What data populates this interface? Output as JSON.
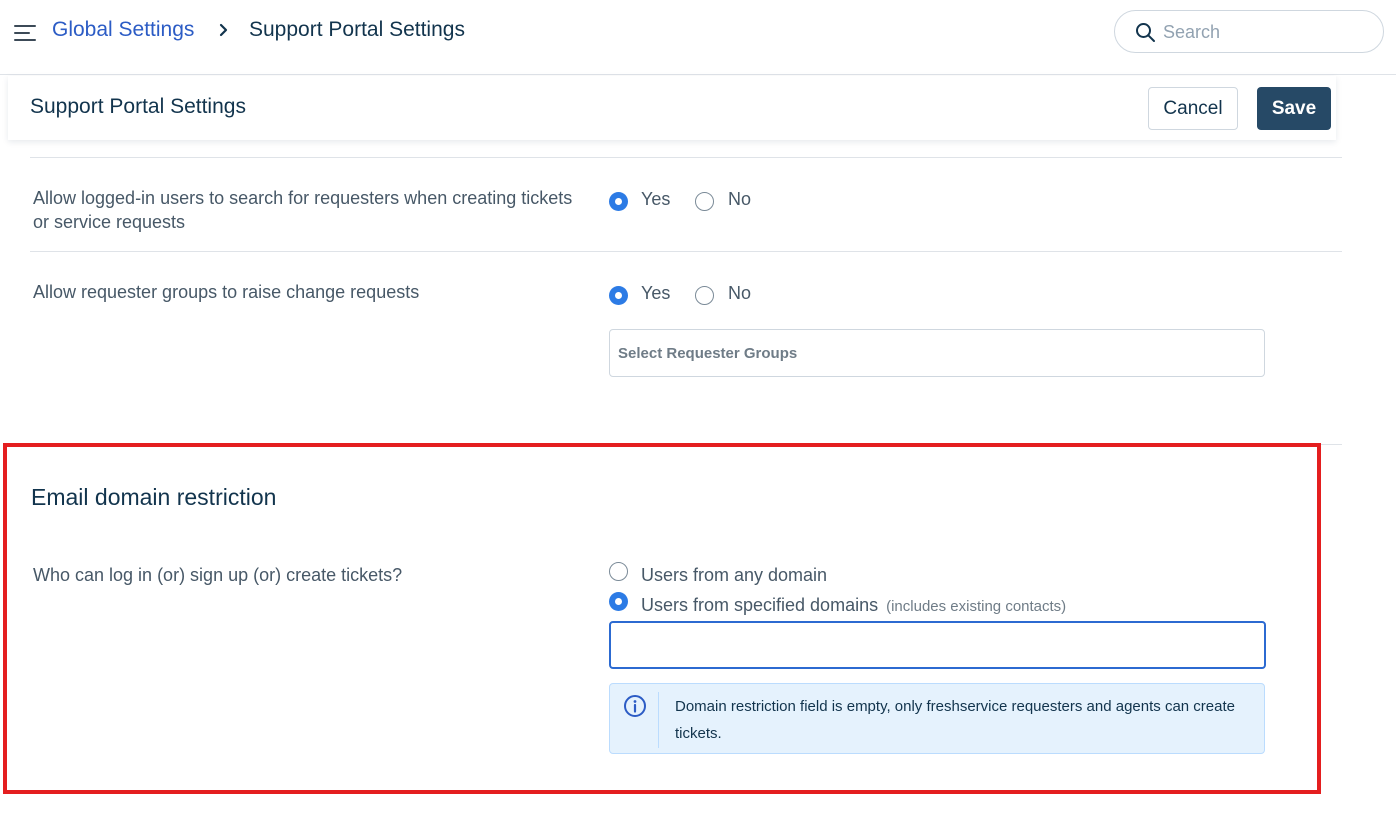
{
  "topbar": {
    "breadcrumb_parent": "Global Settings",
    "breadcrumb_current": "Support Portal Settings",
    "search_placeholder": "Search"
  },
  "header": {
    "title": "Support Portal Settings",
    "cancel_label": "Cancel",
    "save_label": "Save"
  },
  "settings": {
    "search_requesters": {
      "label": "Allow logged-in users to search for requesters when creating tickets or service requests",
      "yes_label": "Yes",
      "no_label": "No",
      "selected": "Yes"
    },
    "requester_groups": {
      "label": "Allow requester groups to raise change requests",
      "yes_label": "Yes",
      "no_label": "No",
      "selected": "Yes",
      "select_placeholder": "Select Requester Groups"
    }
  },
  "email_domain": {
    "section_title": "Email domain restriction",
    "question": "Who can log in (or) sign up (or) create tickets?",
    "option_any": "Users from any domain",
    "option_specified": "Users from specified domains",
    "option_specified_hint": "(includes existing contacts)",
    "selected": "Users from specified domains",
    "domains_value": "",
    "info_message": "Domain restriction field is empty, only freshservice requesters and agents can create tickets."
  },
  "colors": {
    "accent_blue": "#2c7be5",
    "link_blue": "#2c5cc5",
    "save_button": "#264966",
    "highlight_frame": "#e41e1f",
    "info_background": "#e5f2fd"
  },
  "icons": [
    "menu-icon",
    "chevron-right-icon",
    "search-icon",
    "info-icon"
  ]
}
